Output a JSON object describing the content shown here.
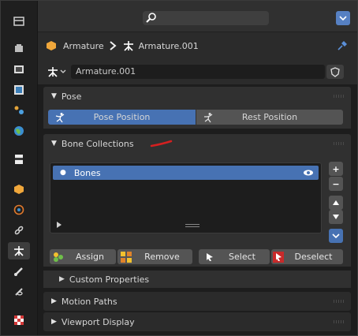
{
  "breadcrumb": {
    "object": "Armature",
    "data": "Armature.001"
  },
  "datablock": {
    "name": "Armature.001"
  },
  "pose_panel": {
    "title": "Pose",
    "pose_position": "Pose Position",
    "rest_position": "Rest Position",
    "active": "pose_position"
  },
  "bone_collections": {
    "title": "Bone Collections",
    "items": [
      {
        "name": "Bones",
        "selected": true,
        "visible": true
      }
    ],
    "buttons": {
      "assign": "Assign",
      "remove": "Remove",
      "select": "Select",
      "deselect": "Deselect"
    },
    "side_buttons": {
      "add": "+",
      "remove": "−"
    }
  },
  "custom_properties": {
    "title": "Custom Properties"
  },
  "motion_paths": {
    "title": "Motion Paths"
  },
  "viewport_display": {
    "title": "Viewport Display"
  },
  "colors": {
    "accent": "#4772b3",
    "button": "#545454",
    "panel": "#303030",
    "field": "#1d1d1d",
    "annotation": "#d42020"
  }
}
